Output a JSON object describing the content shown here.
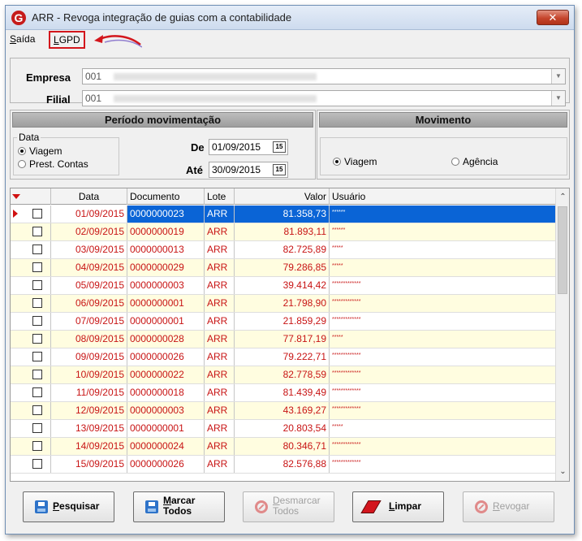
{
  "window": {
    "title": "ARR - Revoga integração de guias com a contabilidade",
    "close_label": "✕",
    "logo_letter": "G"
  },
  "menu": {
    "saida_accel": "S",
    "saida_rest": "aída",
    "lgpd_accel": "L",
    "lgpd_rest": "GPD"
  },
  "company": {
    "empresa_label": "Empresa",
    "empresa_code": "001",
    "filial_label": "Filial",
    "filial_code": "001"
  },
  "periodo": {
    "header": "Período movimentação",
    "group_title": "Data",
    "options": [
      "Viagem",
      "Prest. Contas"
    ],
    "selected": "Viagem",
    "de_label": "De",
    "de_value": "01/09/2015",
    "ate_label": "Até",
    "ate_value": "30/09/2015",
    "calendar_icon_text": "15"
  },
  "movimento": {
    "header": "Movimento",
    "options": [
      "Viagem",
      "Agência"
    ],
    "selected": "Viagem"
  },
  "grid": {
    "columns": [
      "Data",
      "Documento",
      "Lote",
      "Valor",
      "Usuário"
    ],
    "rows": [
      {
        "data": "01/09/2015",
        "documento": "0000000023",
        "lote": "ARR",
        "valor": "81.358,73",
        "usuario": "******"
      },
      {
        "data": "02/09/2015",
        "documento": "0000000019",
        "lote": "ARR",
        "valor": "81.893,11",
        "usuario": "******"
      },
      {
        "data": "03/09/2015",
        "documento": "0000000013",
        "lote": "ARR",
        "valor": "82.725,89",
        "usuario": "*****"
      },
      {
        "data": "04/09/2015",
        "documento": "0000000029",
        "lote": "ARR",
        "valor": "79.286,85",
        "usuario": "*****"
      },
      {
        "data": "05/09/2015",
        "documento": "0000000003",
        "lote": "ARR",
        "valor": "39.414,42",
        "usuario": "*************"
      },
      {
        "data": "06/09/2015",
        "documento": "0000000001",
        "lote": "ARR",
        "valor": "21.798,90",
        "usuario": "*************"
      },
      {
        "data": "07/09/2015",
        "documento": "0000000001",
        "lote": "ARR",
        "valor": "21.859,29",
        "usuario": "*************"
      },
      {
        "data": "08/09/2015",
        "documento": "0000000028",
        "lote": "ARR",
        "valor": "77.817,19",
        "usuario": "*****"
      },
      {
        "data": "09/09/2015",
        "documento": "0000000026",
        "lote": "ARR",
        "valor": "79.222,71",
        "usuario": "*************"
      },
      {
        "data": "10/09/2015",
        "documento": "0000000022",
        "lote": "ARR",
        "valor": "82.778,59",
        "usuario": "*************"
      },
      {
        "data": "11/09/2015",
        "documento": "0000000018",
        "lote": "ARR",
        "valor": "81.439,49",
        "usuario": "*************"
      },
      {
        "data": "12/09/2015",
        "documento": "0000000003",
        "lote": "ARR",
        "valor": "43.169,27",
        "usuario": "*************"
      },
      {
        "data": "13/09/2015",
        "documento": "0000000001",
        "lote": "ARR",
        "valor": "20.803,54",
        "usuario": "*****"
      },
      {
        "data": "14/09/2015",
        "documento": "0000000024",
        "lote": "ARR",
        "valor": "80.346,71",
        "usuario": "*************"
      },
      {
        "data": "15/09/2015",
        "documento": "0000000026",
        "lote": "ARR",
        "valor": "82.576,88",
        "usuario": "*************"
      }
    ]
  },
  "buttons": {
    "pesquisar": {
      "accel": "P",
      "rest": "esquisar"
    },
    "marcar": {
      "accel": "M",
      "line1_rest": "arcar",
      "line2": "Todos"
    },
    "desmarcar": {
      "accel": "D",
      "line1_rest": "esmarcar",
      "line2": "Todos"
    },
    "limpar": {
      "accel": "L",
      "rest": "impar"
    },
    "revogar": {
      "accel": "R",
      "rest": "evogar"
    }
  },
  "colors": {
    "selection": "#0a64d6",
    "row_text": "#c81414",
    "alt_row": "#fffde0",
    "highlight_box": "#d3161c"
  }
}
